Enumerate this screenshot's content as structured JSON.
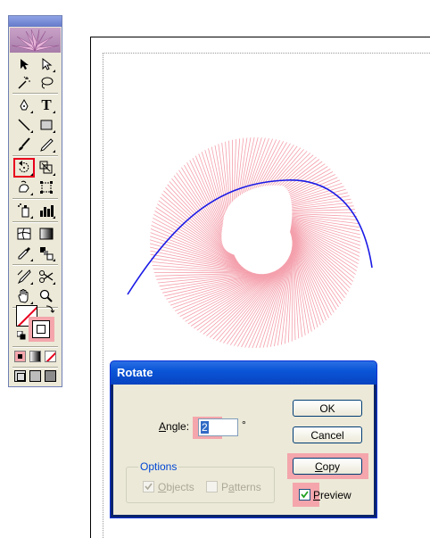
{
  "toolbox": {
    "tools": [
      {
        "name": "selection-tool"
      },
      {
        "name": "direct-selection-tool"
      },
      {
        "name": "magic-wand-tool"
      },
      {
        "name": "lasso-tool"
      },
      {
        "name": "pen-tool"
      },
      {
        "name": "type-tool",
        "glyph": "T"
      },
      {
        "name": "line-segment-tool"
      },
      {
        "name": "rectangle-tool"
      },
      {
        "name": "paintbrush-tool"
      },
      {
        "name": "pencil-tool"
      },
      {
        "name": "rotate-tool",
        "selected": true
      },
      {
        "name": "scale-tool"
      },
      {
        "name": "warp-tool"
      },
      {
        "name": "free-transform-tool"
      },
      {
        "name": "symbol-sprayer-tool"
      },
      {
        "name": "column-graph-tool"
      },
      {
        "name": "mesh-tool"
      },
      {
        "name": "gradient-tool"
      },
      {
        "name": "eyedropper-tool"
      },
      {
        "name": "blend-tool"
      },
      {
        "name": "slice-tool"
      },
      {
        "name": "scissors-tool"
      },
      {
        "name": "hand-tool"
      },
      {
        "name": "zoom-tool"
      }
    ],
    "highlight_color": "#e8001c"
  },
  "artwork": {
    "stroke_color": "#f4a0ac",
    "path_color": "#1a1ae6"
  },
  "dialog": {
    "title": "Rotate",
    "angle_label_u": "A",
    "angle_label_rest": "ngle:",
    "angle_value": "2",
    "degree_symbol": "°",
    "ok_label": "OK",
    "cancel_label": "Cancel",
    "copy_label_u": "C",
    "copy_label_rest": "opy",
    "options_legend": "Options",
    "objects_u": "O",
    "objects_rest": "bjects",
    "objects_checked": true,
    "patterns_u": "a",
    "patterns_pre": "P",
    "patterns_rest": "tterns",
    "patterns_checked": false,
    "preview_u": "P",
    "preview_rest": "review",
    "preview_checked": true,
    "highlight_color": "#f4a6ac"
  }
}
